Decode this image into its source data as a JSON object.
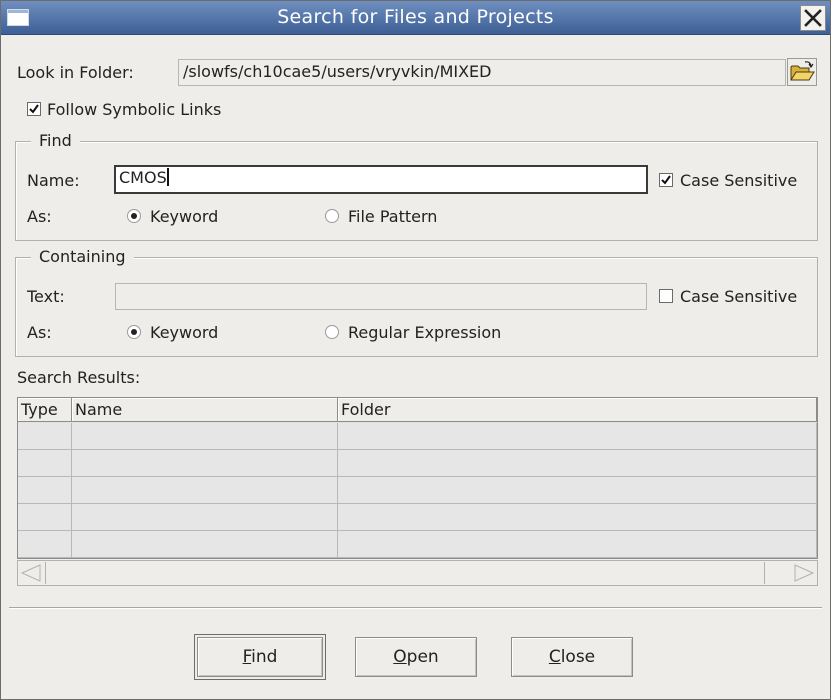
{
  "window": {
    "title": "Search for Files and Projects"
  },
  "look_in": {
    "label": "Look in Folder:",
    "path": "/slowfs/ch10cae5/users/vryvkin/MIXED",
    "browse_icon": "open-folder-icon"
  },
  "follow_symlinks": {
    "label": "Follow Symbolic Links",
    "checked": true
  },
  "find": {
    "legend": "Find",
    "name_label": "Name:",
    "name_value": "CMOS",
    "case_label": "Case Sensitive",
    "case_checked": true,
    "as_label": "As:",
    "opt_keyword": "Keyword",
    "opt_pattern": "File Pattern",
    "selected": "Keyword"
  },
  "containing": {
    "legend": "Containing",
    "text_label": "Text:",
    "text_value": "",
    "case_label": "Case Sensitive",
    "case_checked": false,
    "as_label": "As:",
    "opt_keyword": "Keyword",
    "opt_regex": "Regular Expression",
    "selected": "Keyword"
  },
  "results": {
    "label": "Search Results:",
    "columns": [
      "Type",
      "Name",
      "Folder"
    ],
    "rows": [
      [
        "",
        "",
        ""
      ],
      [
        "",
        "",
        ""
      ],
      [
        "",
        "",
        ""
      ],
      [
        "",
        "",
        ""
      ],
      [
        "",
        "",
        ""
      ]
    ]
  },
  "buttons": {
    "find": {
      "mnemonic": "F",
      "rest": "ind"
    },
    "open": {
      "mnemonic": "O",
      "rest": "pen"
    },
    "close": {
      "mnemonic": "C",
      "rest": "lose"
    }
  }
}
